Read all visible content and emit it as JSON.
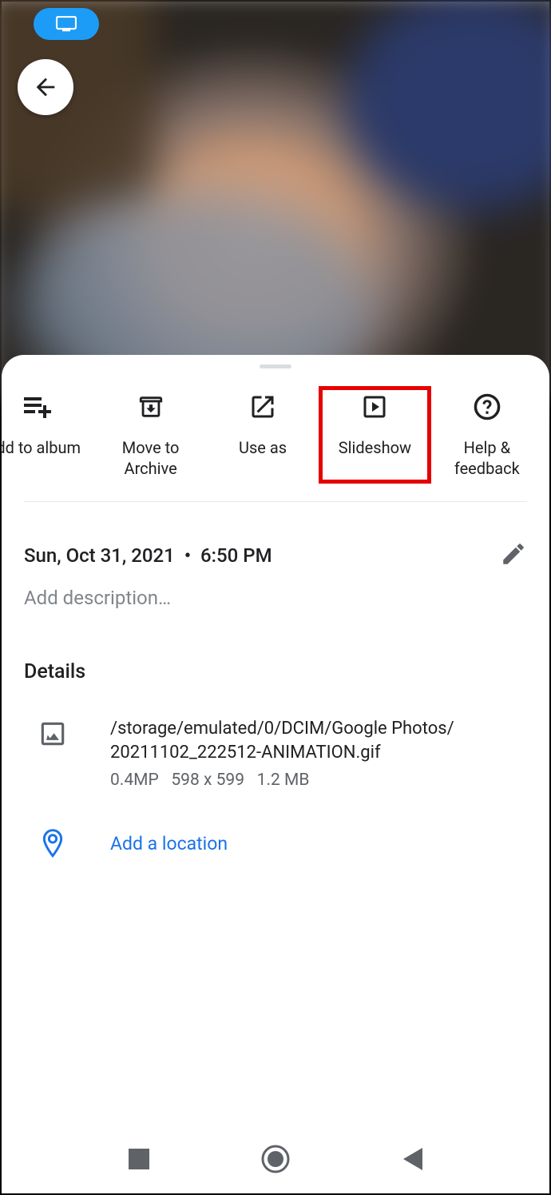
{
  "actions": [
    {
      "label": "dd to album"
    },
    {
      "label": "Move to Archive"
    },
    {
      "label": "Use as"
    },
    {
      "label": "Slideshow"
    },
    {
      "label": "Help & feedback"
    }
  ],
  "datetime": {
    "date": "Sun, Oct 31, 2021",
    "sep": "•",
    "time": "6:50 PM"
  },
  "description_placeholder": "Add description…",
  "details_heading": "Details",
  "file": {
    "path_line1": "/storage/emulated/0/DCIM/Google Photos/",
    "path_line2": "20211102_222512-ANIMATION.gif",
    "megapixels": "0.4MP",
    "dimensions": "598 x 599",
    "size": "1.2 MB"
  },
  "location": {
    "add_label": "Add a location"
  }
}
